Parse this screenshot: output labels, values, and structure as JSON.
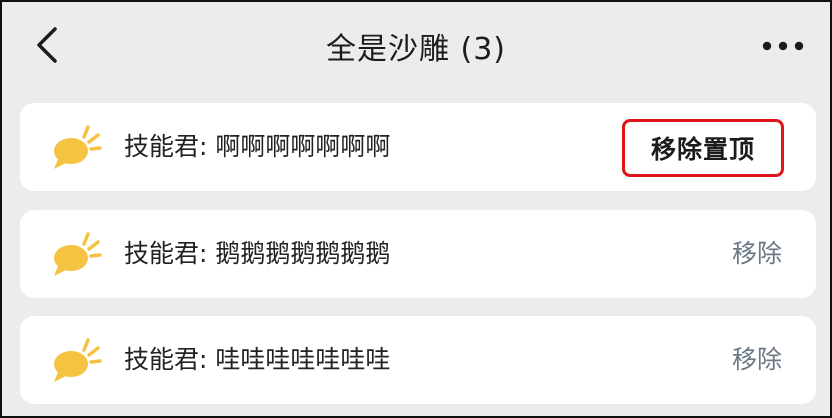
{
  "header": {
    "title": "全是沙雕 (3)",
    "back_icon": "chevron-left-icon",
    "more_icon": "more-dots-icon"
  },
  "items": [
    {
      "text": "技能君: 啊啊啊啊啊啊啊",
      "action": "移除置顶",
      "icon": "chat-bubble-icon"
    },
    {
      "text": "技能君: 鹅鹅鹅鹅鹅鹅鹅",
      "action": "移除",
      "icon": "chat-bubble-icon"
    },
    {
      "text": "技能君: 哇哇哇哇哇哇哇",
      "action": "移除",
      "icon": "chat-bubble-icon"
    }
  ],
  "colors": {
    "background": "#ececec",
    "card": "#ffffff",
    "icon_yellow": "#f5c242",
    "highlight_red": "#e0141b",
    "link_gray": "#6b7787"
  }
}
